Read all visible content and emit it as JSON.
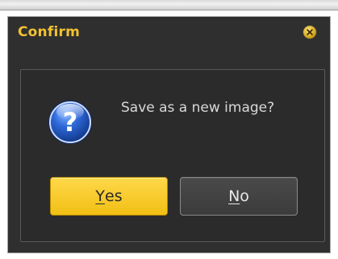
{
  "dialog": {
    "title": "Confirm",
    "message": "Save as a new image?",
    "icon": "question-icon",
    "buttons": {
      "yes": {
        "mnemonic": "Y",
        "rest": "es"
      },
      "no": {
        "mnemonic": "N",
        "rest": "o"
      }
    },
    "close_icon": "close-icon"
  },
  "colors": {
    "title": "#f2c230",
    "dialog_bg": "#2f2f2f",
    "yes_button": "#f1bf14",
    "no_button": "#3b3b3b",
    "message_text": "#d8d8d8"
  }
}
